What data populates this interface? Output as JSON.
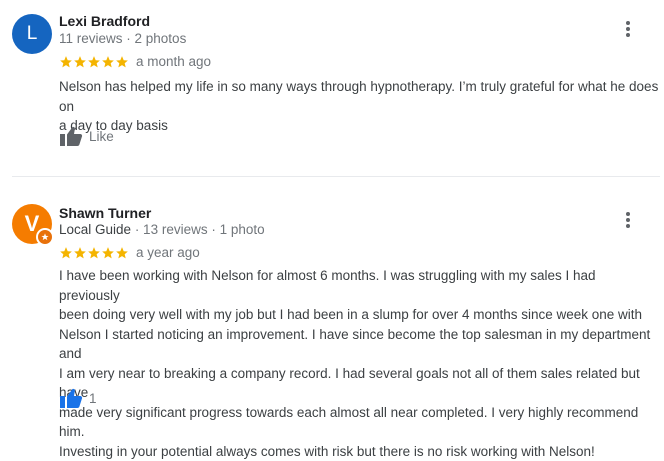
{
  "colors": {
    "star": "#f4b400",
    "avatar_l": "#1565c0",
    "avatar_v": "#f57c00",
    "like_active": "#1a73e8",
    "like_inactive": "#5f6368"
  },
  "reviews": [
    {
      "avatar_letter": "L",
      "name": "Lexi Bradford",
      "meta": "11 reviews · 2 photos",
      "rating": 5,
      "age": "a month ago",
      "lines": [
        "Nelson has helped my life in so many ways through hypnotherapy. I’m truly grateful for what he does on",
        "a day to day basis"
      ],
      "like_label": "Like",
      "menu_icon": "more-vert-icon"
    },
    {
      "avatar_letter": "V",
      "name": "Shawn Turner",
      "guide_label": "Local Guide",
      "meta": " · 13 reviews · 1 photo",
      "rating": 5,
      "age": "a year ago",
      "lines": [
        "I have been working with Nelson for almost 6 months. I was struggling with my sales I had previously",
        "been doing very well with my job but I had been in a slump for over 4 months since week one with",
        "Nelson I started noticing an improvement. I have since become the top salesman in my department and",
        "I am very near to breaking a company record. I had several goals not all of them sales related but have",
        "made very significant progress towards each almost all near completed. I very highly recommend him.",
        "Investing in your potential always comes with risk but there is no risk working with Nelson!"
      ],
      "like_count": "1",
      "menu_icon": "more-vert-icon"
    }
  ]
}
